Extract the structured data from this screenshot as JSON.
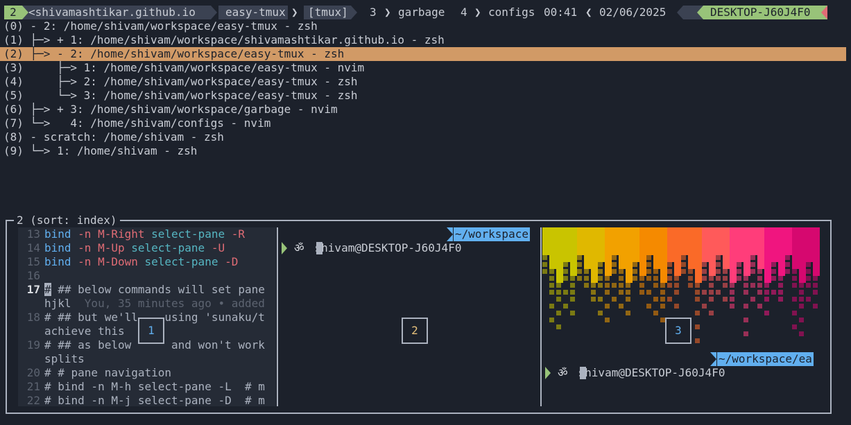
{
  "statusbar": {
    "session_index": "2",
    "session_name": "<shivamashtikar.github.io",
    "window_active": "easy-tmux",
    "window_tag": "[tmux]",
    "window3_index": "3",
    "window3_name": "garbage",
    "window4_index": "4",
    "window4_name": "configs",
    "time": "00:41",
    "date": "02/06/2025",
    "host": "DESKTOP-J60J4F0",
    "colors": {
      "green": "#98c379",
      "segment": "#3b4252",
      "red": "#e06c75"
    }
  },
  "tree": [
    {
      "index": "(0)",
      "branch": " - ",
      "text": "2: /home/shivam/workspace/easy-tmux - zsh"
    },
    {
      "index": "(1)",
      "branch": " ├─> ",
      "text": "+ 1: /home/shivam/workspace/shivamashtikar.github.io - zsh"
    },
    {
      "index": "(2)",
      "branch": " ├─> ",
      "text": "- 2: /home/shivam/workspace/easy-tmux - zsh"
    },
    {
      "index": "(3)",
      "branch": "     ├─> ",
      "text": "1: /home/shivam/workspace/easy-tmux - nvim"
    },
    {
      "index": "(4)",
      "branch": "     ├─> ",
      "text": "2: /home/shivam/workspace/easy-tmux - zsh"
    },
    {
      "index": "(5)",
      "branch": "     └─> ",
      "text": "3: /home/shivam/workspace/easy-tmux - zsh"
    },
    {
      "index": "(6)",
      "branch": " ├─> ",
      "text": "+ 3: /home/shivam/workspace/garbage - nvim"
    },
    {
      "index": "(7)",
      "branch": " └─>   ",
      "text": "4: /home/shivam/configs - nvim"
    },
    {
      "index": "(8)",
      "branch": " - ",
      "text": "scratch: /home/shivam - zsh"
    },
    {
      "index": "(9)",
      "branch": " └─> ",
      "text": "1: /home/shivam - zsh"
    }
  ],
  "tree_selected_index": 2,
  "tree_highlight_color": "#d19a66",
  "preview": {
    "title": "2 (sort: index)",
    "pane_numbers": [
      "1",
      "2",
      "3"
    ]
  },
  "editor": {
    "lines": [
      {
        "num": "13",
        "parts": [
          "bind",
          " -n ",
          "M-Right",
          " select-pane",
          " -R"
        ]
      },
      {
        "num": "14",
        "parts": [
          "bind",
          " -n ",
          "M-Up",
          " select-pane",
          " -U"
        ]
      },
      {
        "num": "15",
        "parts": [
          "bind",
          " -n ",
          "M-Down",
          " select-pane",
          " -D"
        ]
      },
      {
        "num": "16",
        "parts": []
      },
      {
        "num": "17",
        "text": " ## below commands will set pane",
        "cursor": "#"
      },
      {
        "num": "",
        "text": "hjkl",
        "blame": "  You, 35 minutes ago • added"
      },
      {
        "num": "18",
        "text": "# ## but we'll    using 'sunaku/t"
      },
      {
        "num": "",
        "text": "achieve this"
      },
      {
        "num": "19",
        "text": "# ## as below      and won't work"
      },
      {
        "num": "",
        "text": "splits"
      },
      {
        "num": "20",
        "text": "# # pane navigation"
      },
      {
        "num": "21",
        "text": "# bind -n M-h select-pane -L  # m"
      },
      {
        "num": "22",
        "text": "# bind -n M-j select-pane -D  # m"
      }
    ]
  },
  "pane2": {
    "user": "shivam@DESKTOP-J60J4F0",
    "path": "~/workspace",
    "symbol": "ॐ"
  },
  "pane3": {
    "user": "shivam@DESKTOP-J60J4F0",
    "path": "~/workspace/ea",
    "symbol": "ॐ"
  }
}
